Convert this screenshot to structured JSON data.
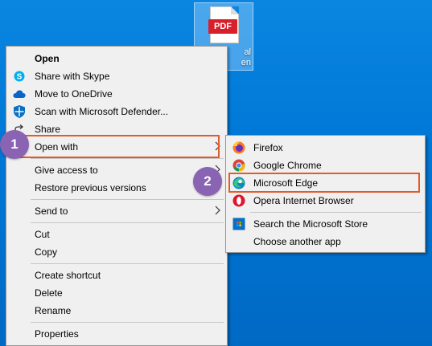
{
  "desktop": {
    "file": {
      "badge": "PDF",
      "label": "al\nen"
    }
  },
  "context_menu": {
    "items": [
      {
        "label": "Open",
        "icon": "none"
      },
      {
        "label": "Share with Skype",
        "icon": "skype-icon"
      },
      {
        "label": "Move to OneDrive",
        "icon": "onedrive-icon"
      },
      {
        "label": "Scan with Microsoft Defender...",
        "icon": "defender-icon"
      },
      {
        "label": "Share",
        "icon": "share-icon"
      },
      {
        "label": "Open with",
        "icon": "none"
      },
      {
        "label": "Give access to",
        "icon": "none"
      },
      {
        "label": "Restore previous versions",
        "icon": "none"
      },
      {
        "label": "Send to",
        "icon": "none"
      },
      {
        "label": "Cut",
        "icon": "none"
      },
      {
        "label": "Copy",
        "icon": "none"
      },
      {
        "label": "Create shortcut",
        "icon": "none"
      },
      {
        "label": "Delete",
        "icon": "none"
      },
      {
        "label": "Rename",
        "icon": "none"
      },
      {
        "label": "Properties",
        "icon": "none"
      }
    ],
    "submenu_arrow": "›"
  },
  "open_with_menu": {
    "items": [
      {
        "label": "Firefox",
        "icon": "firefox-icon"
      },
      {
        "label": "Google Chrome",
        "icon": "chrome-icon"
      },
      {
        "label": "Microsoft Edge",
        "icon": "edge-icon"
      },
      {
        "label": "Opera Internet Browser",
        "icon": "opera-icon"
      },
      {
        "label": "Search the Microsoft Store",
        "icon": "store-icon"
      },
      {
        "label": "Choose another app",
        "icon": "none"
      }
    ]
  },
  "annotations": {
    "step1": "1",
    "step2": "2",
    "highlight_color": "#e35b2a",
    "badge_color": "#8a63b3"
  }
}
